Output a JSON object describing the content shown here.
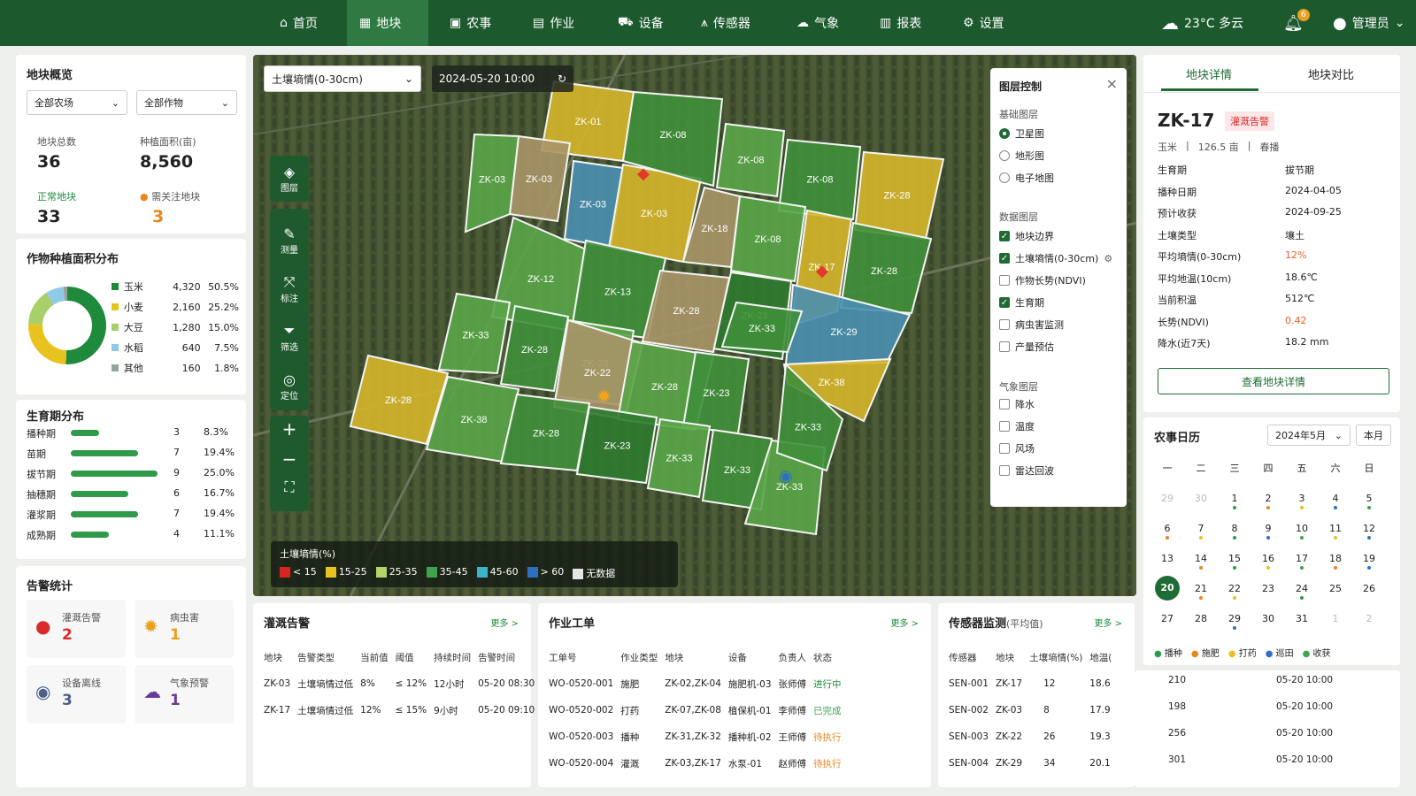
{
  "nav": {
    "items": [
      {
        "label": "首页",
        "icon": "home-icon"
      },
      {
        "label": "地块",
        "icon": "grid-icon"
      },
      {
        "label": "农事",
        "icon": "calendar-icon"
      },
      {
        "label": "作业",
        "icon": "tractor-icon"
      },
      {
        "label": "设备",
        "icon": "car-icon"
      },
      {
        "label": "传感器",
        "icon": "signal-icon"
      },
      {
        "label": "气象",
        "icon": "weather-icon"
      },
      {
        "label": "报表",
        "icon": "report-icon"
      },
      {
        "label": "设置",
        "icon": "gear-icon"
      }
    ],
    "weather": "23°C 多云",
    "bell_count": "6",
    "user": "管理员"
  },
  "overview": {
    "title": "地块概览",
    "farm_select": "全部农场",
    "crop_select": "全部作物",
    "total_label": "地块总数",
    "total": "36",
    "area_label": "种植面积(亩)",
    "area": "8,560",
    "normal_label": "正常地块",
    "normal": "33",
    "attention_label": "需关注地块",
    "attention": "3"
  },
  "crops": {
    "title": "作物种植面积分布",
    "items": [
      {
        "name": "玉米",
        "area": "4,320",
        "pct": "50.5%",
        "value": 50.5,
        "color": "#1f8a3c"
      },
      {
        "name": "小麦",
        "area": "2,160",
        "pct": "25.2%",
        "value": 25.2,
        "color": "#e8c21f"
      },
      {
        "name": "大豆",
        "area": "1,280",
        "pct": "15.0%",
        "value": 15.0,
        "color": "#a7cf6a"
      },
      {
        "name": "水稻",
        "area": "640",
        "pct": "7.5%",
        "value": 7.5,
        "color": "#8fcbe8"
      },
      {
        "name": "其他",
        "area": "160",
        "pct": "1.8%",
        "value": 1.8,
        "color": "#9aa39a"
      }
    ]
  },
  "stages": {
    "title": "生育期分布",
    "items": [
      {
        "name": "播种期",
        "count": "3",
        "pct": "8.3%",
        "value": 8.3
      },
      {
        "name": "苗期",
        "count": "7",
        "pct": "19.4%",
        "value": 19.4
      },
      {
        "name": "拔节期",
        "count": "9",
        "pct": "25.0%",
        "value": 25.0
      },
      {
        "name": "抽穗期",
        "count": "6",
        "pct": "16.7%",
        "value": 16.7
      },
      {
        "name": "灌浆期",
        "count": "7",
        "pct": "19.4%",
        "value": 19.4
      },
      {
        "name": "成熟期",
        "count": "4",
        "pct": "11.1%",
        "value": 11.1
      }
    ]
  },
  "alerts": {
    "title": "告警统计",
    "items": [
      {
        "name": "灌溉告警",
        "count": "2",
        "color": "#d92b2b"
      },
      {
        "name": "病虫害",
        "count": "1",
        "color": "#e8a11f"
      },
      {
        "name": "设备离线",
        "count": "3",
        "color": "#4a5f8a"
      },
      {
        "name": "气象预警",
        "count": "1",
        "color": "#6a3a9a"
      }
    ]
  },
  "map": {
    "layer_select": "土壤墒情(0-30cm)",
    "datetime": "2024-05-20 10:00",
    "tools": [
      "图层",
      "测量",
      "标注",
      "筛选",
      "定位"
    ],
    "legend": {
      "title": "土壤墒情(%)",
      "items": [
        {
          "label": "< 15",
          "color": "#d92424"
        },
        {
          "label": "15-25",
          "color": "#e8c21f"
        },
        {
          "label": "25-35",
          "color": "#b6d46a"
        },
        {
          "label": "35-45",
          "color": "#3fa24f"
        },
        {
          "label": "45-60",
          "color": "#3bb4c8"
        },
        {
          "label": "> 60",
          "color": "#2e6fc0"
        },
        {
          "label": "无数据",
          "color": "#e6e6e6"
        }
      ]
    },
    "plots": [
      "ZK-01",
      "ZK-03",
      "ZK-03",
      "ZK-03",
      "ZK-03",
      "ZK-08",
      "ZK-08",
      "ZK-08",
      "ZK-28",
      "ZK-12",
      "ZK-13",
      "ZK-18",
      "ZK-08",
      "ZK-17",
      "ZK-28",
      "ZK-33",
      "ZK-28",
      "ZK-23",
      "ZK-28",
      "ZK-23",
      "ZK-29",
      "ZK-38",
      "ZK-22",
      "ZK-28",
      "ZK-23",
      "ZK-28",
      "ZK-38",
      "ZK-28",
      "ZK-23",
      "ZK-33",
      "ZK-33",
      "ZK-33",
      "ZK-33",
      "ZK-33"
    ]
  },
  "layers": {
    "title": "图层控制",
    "base_title": "基础图层",
    "base": [
      {
        "label": "卫星图",
        "on": true
      },
      {
        "label": "地形图",
        "on": false
      },
      {
        "label": "电子地图",
        "on": false
      }
    ],
    "data_title": "数据图层",
    "data": [
      {
        "label": "地块边界",
        "on": true
      },
      {
        "label": "土壤墒情(0-30cm)",
        "on": true
      },
      {
        "label": "作物长势(NDVI)",
        "on": false
      },
      {
        "label": "生育期",
        "on": true
      },
      {
        "label": "病虫害监测",
        "on": false
      },
      {
        "label": "产量预估",
        "on": false
      }
    ],
    "weather_title": "气象图层",
    "weather": [
      {
        "label": "降水",
        "on": false
      },
      {
        "label": "温度",
        "on": false
      },
      {
        "label": "风场",
        "on": false
      },
      {
        "label": "雷达回波",
        "on": false
      }
    ]
  },
  "detail": {
    "tab1": "地块详情",
    "tab2": "地块对比",
    "id": "ZK-17",
    "badge": "灌溉告警",
    "crop": "玉米",
    "area": "126.5 亩",
    "season": "春播",
    "rows": [
      {
        "k": "生育期",
        "v": "拔节期"
      },
      {
        "k": "播种日期",
        "v": "2024-04-05"
      },
      {
        "k": "预计收获",
        "v": "2024-09-25"
      },
      {
        "k": "土壤类型",
        "v": "壤土"
      },
      {
        "k": "平均墒情(0-30cm)",
        "v": "12%",
        "warn": true
      },
      {
        "k": "平均地温(10cm)",
        "v": "18.6℃"
      },
      {
        "k": "当前积温",
        "v": "512℃"
      },
      {
        "k": "长势(NDVI)",
        "v": "0.42",
        "warn": true
      },
      {
        "k": "降水(近7天)",
        "v": "18.2 mm"
      }
    ],
    "button": "查看地块详情"
  },
  "calendar": {
    "title": "农事日历",
    "month": "2024年5月",
    "this_month": "本月",
    "weekdays": [
      "一",
      "二",
      "三",
      "四",
      "五",
      "六",
      "日"
    ],
    "weeks": [
      [
        "29",
        "30",
        "1",
        "2",
        "3",
        "4",
        "5"
      ],
      [
        "6",
        "7",
        "8",
        "9",
        "10",
        "11",
        "12"
      ],
      [
        "13",
        "14",
        "15",
        "16",
        "17",
        "18",
        "19"
      ],
      [
        "20",
        "21",
        "22",
        "23",
        "24",
        "25",
        "26"
      ],
      [
        "27",
        "28",
        "29",
        "30",
        "31",
        "1",
        "2"
      ]
    ],
    "legend": [
      {
        "label": "播种",
        "color": "#2e9a4a"
      },
      {
        "label": "施肥",
        "color": "#e8861f"
      },
      {
        "label": "打药",
        "color": "#e8c21f"
      },
      {
        "label": "巡田",
        "color": "#2e6fc0"
      },
      {
        "label": "收获",
        "color": "#3fa24f"
      }
    ]
  },
  "irrigation": {
    "title": "灌溉告警",
    "more": "更多 >",
    "headers": [
      "地块",
      "告警类型",
      "当前值",
      "阈值",
      "持续时间",
      "告警时间"
    ],
    "rows": [
      [
        "ZK-03",
        "土壤墒情过低",
        "8%",
        "≤ 12%",
        "12小时",
        "05-20 08:30"
      ],
      [
        "ZK-17",
        "土壤墒情过低",
        "12%",
        "≤ 15%",
        "9小时",
        "05-20 09:10"
      ]
    ]
  },
  "orders": {
    "title": "作业工单",
    "more": "更多 >",
    "headers": [
      "工单号",
      "作业类型",
      "地块",
      "设备",
      "负责人",
      "状态"
    ],
    "rows": [
      [
        "WO-0520-001",
        "施肥",
        "ZK-02,ZK-04",
        "施肥机-03",
        "张师傅",
        "进行中"
      ],
      [
        "WO-0520-002",
        "打药",
        "ZK-07,ZK-08",
        "植保机-01",
        "李师傅",
        "已完成"
      ],
      [
        "WO-0520-003",
        "播种",
        "ZK-31,ZK-32",
        "播种机-02",
        "王师傅",
        "待执行"
      ],
      [
        "WO-0520-004",
        "灌溉",
        "ZK-03,ZK-17",
        "水泵-01",
        "赵师傅",
        "待执行"
      ]
    ]
  },
  "sensors": {
    "title": "传感器监测",
    "subtitle": "(平均值)",
    "more": "更多 >",
    "headers": [
      "传感器",
      "地块",
      "土壤墒情(%)",
      "地温(",
      "",
      ""
    ],
    "rows": [
      [
        "SEN-001",
        "ZK-17",
        "12",
        "18.6",
        "210",
        "05-20 10:00"
      ],
      [
        "SEN-002",
        "ZK-03",
        "8",
        "17.9",
        "198",
        "05-20 10:00"
      ],
      [
        "SEN-003",
        "ZK-22",
        "26",
        "19.3",
        "256",
        "05-20 10:00"
      ],
      [
        "SEN-004",
        "ZK-29",
        "34",
        "20.1",
        "301",
        "05-20 10:00"
      ]
    ]
  }
}
